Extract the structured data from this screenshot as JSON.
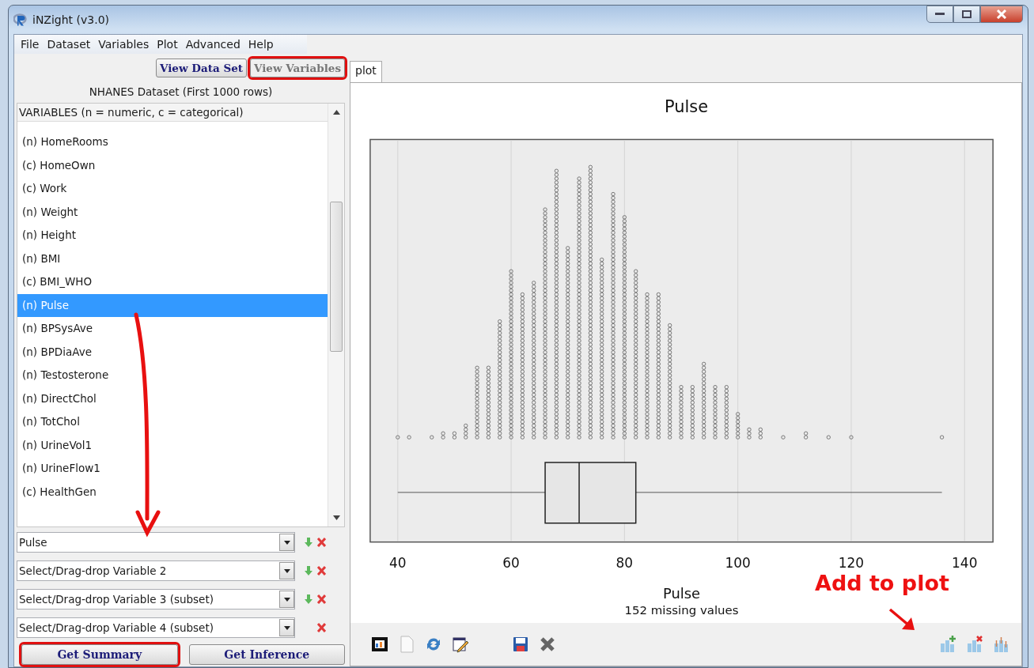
{
  "window": {
    "title": "iNZight (v3.0)"
  },
  "menu": [
    "File",
    "Dataset",
    "Variables",
    "Plot",
    "Advanced",
    "Help"
  ],
  "view_buttons": [
    {
      "label": "View Data Set",
      "disabled": false,
      "highlighted": false
    },
    {
      "label": "View Variables",
      "disabled": true,
      "highlighted": true
    }
  ],
  "dataset_label": "NHANES Dataset (First 1000 rows)",
  "variables": {
    "header": "VARIABLES (n = numeric, c = categorical)",
    "items": [
      {
        "label": "(n) HomeRooms",
        "selected": false
      },
      {
        "label": "(c) HomeOwn",
        "selected": false
      },
      {
        "label": "(c) Work",
        "selected": false
      },
      {
        "label": "(n) Weight",
        "selected": false
      },
      {
        "label": "(n) Height",
        "selected": false
      },
      {
        "label": "(n) BMI",
        "selected": false
      },
      {
        "label": "(c) BMI_WHO",
        "selected": false
      },
      {
        "label": "(n) Pulse",
        "selected": true
      },
      {
        "label": "(n) BPSysAve",
        "selected": false
      },
      {
        "label": "(n) BPDiaAve",
        "selected": false
      },
      {
        "label": "(n) Testosterone",
        "selected": false
      },
      {
        "label": "(n) DirectChol",
        "selected": false
      },
      {
        "label": "(n) TotChol",
        "selected": false
      },
      {
        "label": "(n) UrineVol1",
        "selected": false
      },
      {
        "label": "(n) UrineFlow1",
        "selected": false
      },
      {
        "label": "(c) HealthGen",
        "selected": false
      }
    ]
  },
  "selectors": [
    {
      "text": "Pulse",
      "add_button": true
    },
    {
      "text": "Select/Drag-drop Variable 2",
      "add_button": true
    },
    {
      "text": "Select/Drag-drop Variable 3 (subset)",
      "add_button": true
    },
    {
      "text": "Select/Drag-drop Variable 4 (subset)",
      "add_button": false
    }
  ],
  "action_buttons": [
    {
      "label": "Get Summary",
      "highlighted": true
    },
    {
      "label": "Get Inference",
      "highlighted": false
    }
  ],
  "tabs": [
    {
      "label": "plot",
      "selected": true
    }
  ],
  "plot": {
    "title": "Pulse",
    "x_ticks": [
      "40",
      "60",
      "80",
      "100",
      "120",
      "140"
    ],
    "xlabel": "Pulse",
    "note": "152 missing values"
  },
  "annotations": {
    "callout": "Add to plot"
  }
}
